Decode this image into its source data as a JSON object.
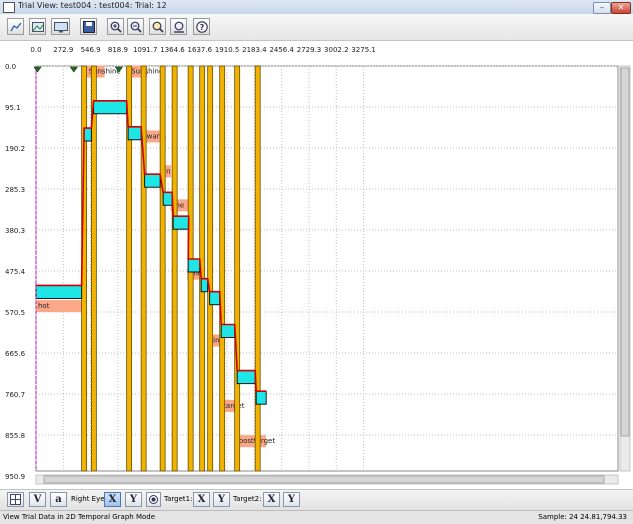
{
  "window": {
    "title": "Trial View: test004 : test004: Trial: 12"
  },
  "statusbar": {
    "left": "View Trial Data in 2D Temporal Graph Mode",
    "right": "Sample: 24  24.81,794.33"
  },
  "bottom": {
    "v_label": "V",
    "a_label": "a",
    "right_eye_label": "Right Eye:",
    "x_label": "X",
    "y_label": "Y",
    "target1_label": "Target1:",
    "target2_label": "Target2:"
  },
  "chart_data": {
    "type": "line",
    "x_ticks": [
      "0.0",
      "272.9",
      "546.9",
      "818.9",
      "1091.7",
      "1364.6",
      "1637.6",
      "1910.5",
      "2183.4",
      "2456.4",
      "2729.3",
      "3002.2",
      "3275.1"
    ],
    "y_ticks": [
      "0.0",
      "95.1",
      "190.2",
      "285.3",
      "380.3",
      "475.4",
      "570.5",
      "665.6",
      "760.7",
      "855.8",
      "950.9"
    ],
    "xlim": [
      0,
      3342
    ],
    "ylim": [
      0,
      965
    ],
    "markers": [
      30,
      757,
      1657
    ],
    "interest_areas": [
      {
        "label": "Sunshine",
        "t0": 1012,
        "t1": 1372,
        "y": 13
      },
      {
        "label": "Sunshine",
        "t0": 1862,
        "t1": 2222,
        "y": 13
      },
      {
        "label": "warm",
        "t0": 2172,
        "t1": 2532,
        "y": 168
      },
      {
        "label": "in",
        "t0": 2522,
        "t1": 2702,
        "y": 251
      },
      {
        "label": "the",
        "t0": 2692,
        "t1": 3052,
        "y": 332
      },
      {
        "label": "and",
        "t0": 3022,
        "t1": 3312,
        "y": 495
      },
      {
        "label": "hot",
        "t0": 0,
        "t1": 912,
        "y": 572
      },
      {
        "label": "in",
        "t0": 3502,
        "t1": 3722,
        "y": 654
      },
      {
        "label": "target",
        "t0": 3702,
        "t1": 4002,
        "y": 810
      },
      {
        "label": "posttarget",
        "t0": 4012,
        "t1": 4602,
        "y": 894
      }
    ],
    "fixations": [
      {
        "t0": 0,
        "t1": 912,
        "y": 530
      },
      {
        "t0": 962,
        "t1": 1107,
        "y": 155
      },
      {
        "t0": 1152,
        "t1": 1812,
        "y": 90
      },
      {
        "t0": 1842,
        "t1": 2102,
        "y": 152
      },
      {
        "t0": 2172,
        "t1": 2482,
        "y": 265
      },
      {
        "t0": 2542,
        "t1": 2722,
        "y": 308
      },
      {
        "t0": 2742,
        "t1": 3052,
        "y": 365
      },
      {
        "t0": 3042,
        "t1": 3272,
        "y": 467
      },
      {
        "t0": 3302,
        "t1": 3432,
        "y": 514
      },
      {
        "t0": 3472,
        "t1": 3672,
        "y": 545
      },
      {
        "t0": 3702,
        "t1": 3972,
        "y": 623
      },
      {
        "t0": 4022,
        "t1": 4382,
        "y": 733
      },
      {
        "t0": 4402,
        "t1": 4602,
        "y": 782
      }
    ],
    "saccades": [
      {
        "t0": 912,
        "t1": 962
      },
      {
        "t0": 1107,
        "t1": 1152
      },
      {
        "t0": 1812,
        "t1": 1842
      },
      {
        "t0": 2102,
        "t1": 2172
      },
      {
        "t0": 2482,
        "t1": 2542
      },
      {
        "t0": 2722,
        "t1": 2742
      },
      {
        "t0": 3052,
        "t1": 3042
      },
      {
        "t0": 3272,
        "t1": 3302
      },
      {
        "t0": 3432,
        "t1": 3472
      },
      {
        "t0": 3672,
        "t1": 3702
      },
      {
        "t0": 3972,
        "t1": 4022
      },
      {
        "t0": 4382,
        "t1": 4402
      }
    ],
    "colors": {
      "fixation": "#1ee6e6",
      "saccade": "#f0b400",
      "interest_area": "#fba889",
      "trace": "#d00000",
      "grid": "#bfbfbf",
      "cursor": "#d000d0",
      "marker": "#1e6e1e"
    }
  }
}
